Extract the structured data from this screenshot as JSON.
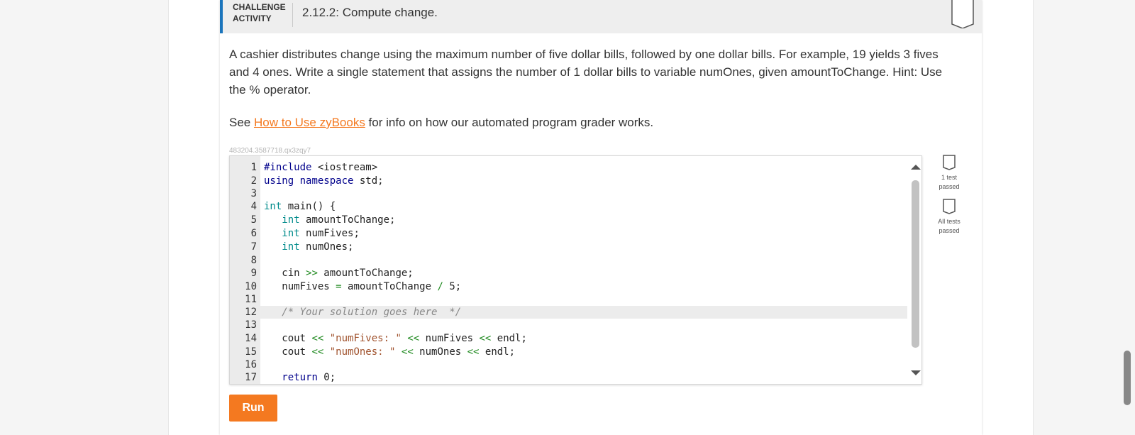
{
  "header": {
    "type_line1": "CHALLENGE",
    "type_line2": "ACTIVITY",
    "title": "2.12.2: Compute change."
  },
  "instructions": "A cashier distributes change using the maximum number of five dollar bills, followed by one dollar bills. For example, 19 yields 3 fives and 4 ones. Write a single statement that assigns the number of 1 dollar bills to variable numOnes, given amountToChange. Hint: Use the % operator.",
  "info": {
    "prefix": "See ",
    "link": "How to Use zyBooks",
    "suffix": " for info on how our automated program grader works."
  },
  "code_id": "483204.3587718.qx3zqy7",
  "editor": {
    "line_numbers": [
      "1",
      "2",
      "3",
      "4",
      "5",
      "6",
      "7",
      "8",
      "9",
      "10",
      "11",
      "12",
      "13",
      "14",
      "15",
      "16",
      "17"
    ],
    "active_line": 12
  },
  "tests": [
    {
      "label_line1": "1 test",
      "label_line2": "passed"
    },
    {
      "label_line1": "All tests",
      "label_line2": "passed"
    }
  ],
  "run_label": "Run",
  "colors": {
    "accent": "#1b75bc",
    "run_button": "#f47920",
    "link": "#f47920"
  }
}
